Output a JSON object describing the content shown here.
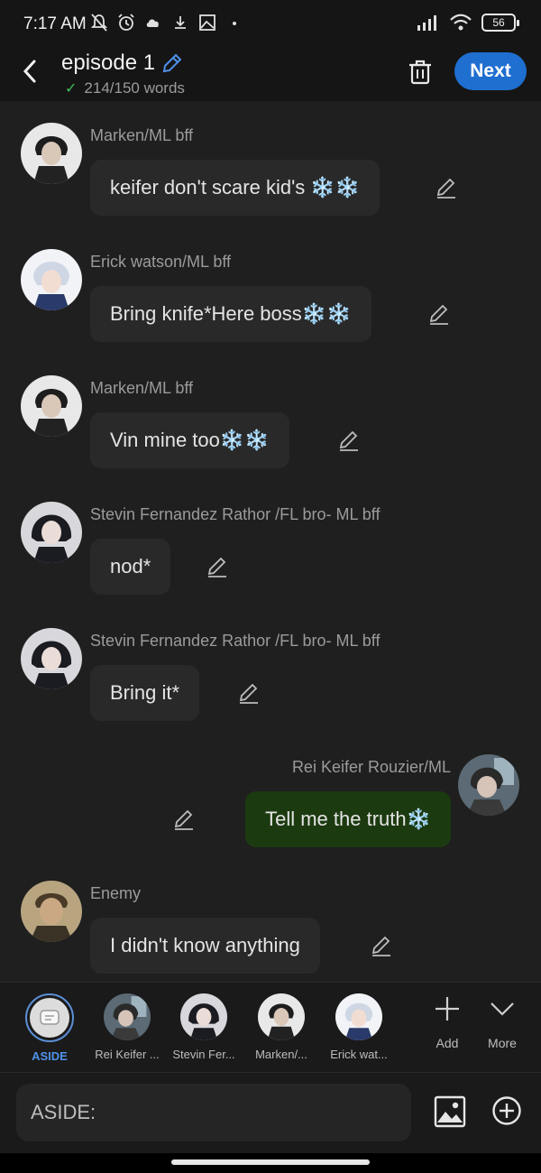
{
  "status": {
    "time": "7:17 AM",
    "battery": "56"
  },
  "header": {
    "title": "episode 1",
    "word_count": "214/150 words",
    "next_label": "Next"
  },
  "messages": [
    {
      "sender": "Marken/ML bff",
      "text": "keifer don't scare kid's ❄️❄️",
      "avatar_color": "#3a3a3a"
    },
    {
      "sender": "Erick watson/ML bff",
      "text": "Bring knife*Here boss❄️❄️",
      "avatar_color": "#c9d4e6"
    },
    {
      "sender": "Marken/ML bff",
      "text": "Vin mine too❄️❄️",
      "avatar_color": "#3a3a3a"
    },
    {
      "sender": "Stevin Fernandez Rathor /FL bro- ML bff",
      "text": "nod*",
      "avatar_color": "#2c2c32"
    },
    {
      "sender": "Stevin Fernandez Rathor /FL bro- ML bff",
      "text": "Bring it*",
      "avatar_color": "#2c2c32"
    },
    {
      "sender": "Rei Keifer Rouzier/ML",
      "text": "Tell me the truth❄️",
      "avatar_color": "#51606a",
      "mine": true
    },
    {
      "sender": "Enemy",
      "text": "I didn't know anything",
      "avatar_color": "#7a6a4e"
    }
  ],
  "characters": [
    {
      "label": "ASIDE"
    },
    {
      "label": "Rei Keifer ..."
    },
    {
      "label": "Stevin Fer..."
    },
    {
      "label": "Marken/..."
    },
    {
      "label": "Erick wat..."
    }
  ],
  "tools": {
    "add_label": "Add",
    "more_label": "More"
  },
  "input": {
    "placeholder": "ASIDE:"
  },
  "colors": {
    "accent": "#1e6fd0",
    "my_bubble": "#1c3a10",
    "other_bubble": "#292929",
    "aside": "#4f91e8"
  }
}
